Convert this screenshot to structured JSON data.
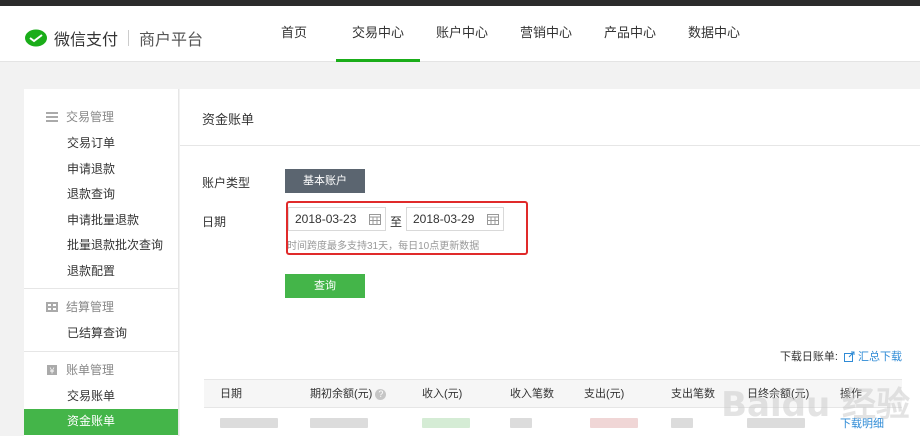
{
  "brand": {
    "name": "微信支付",
    "sub": "商户平台"
  },
  "nav": [
    {
      "label": "首页"
    },
    {
      "label": "交易中心"
    },
    {
      "label": "账户中心"
    },
    {
      "label": "营销中心"
    },
    {
      "label": "产品中心"
    },
    {
      "label": "数据中心"
    }
  ],
  "sidebar": {
    "groups": [
      {
        "title": "交易管理",
        "items": [
          "交易订单",
          "申请退款",
          "退款查询",
          "申请批量退款",
          "批量退款批次查询",
          "退款配置"
        ]
      },
      {
        "title": "结算管理",
        "items": [
          "已结算查询"
        ]
      },
      {
        "title": "账单管理",
        "items": [
          "交易账单",
          "资金账单"
        ]
      }
    ],
    "active": "资金账单"
  },
  "main": {
    "title": "资金账单",
    "account_type_label": "账户类型",
    "account_type_value": "基本账户",
    "date_label": "日期",
    "date_from": "2018-03-23",
    "to_text": "至",
    "date_to": "2018-03-29",
    "hint": "时间跨度最多支持31天，每日10点更新数据",
    "query_button": "查询",
    "download_daily": "下载日账单:",
    "download_summary": "汇总下载"
  },
  "table": {
    "columns": [
      "日期",
      "期初余额(元)",
      "收入(元)",
      "收入笔数",
      "支出(元)",
      "支出笔数",
      "日终余额(元)",
      "操作"
    ],
    "row_action": "下载明细"
  },
  "watermark": "Baidu 经验",
  "colors": {
    "brand_green": "#1aad19",
    "active_green": "#44b549",
    "link_blue": "#2f8bd6",
    "highlight_red": "#e02a2a",
    "account_btn": "#5b6570"
  }
}
